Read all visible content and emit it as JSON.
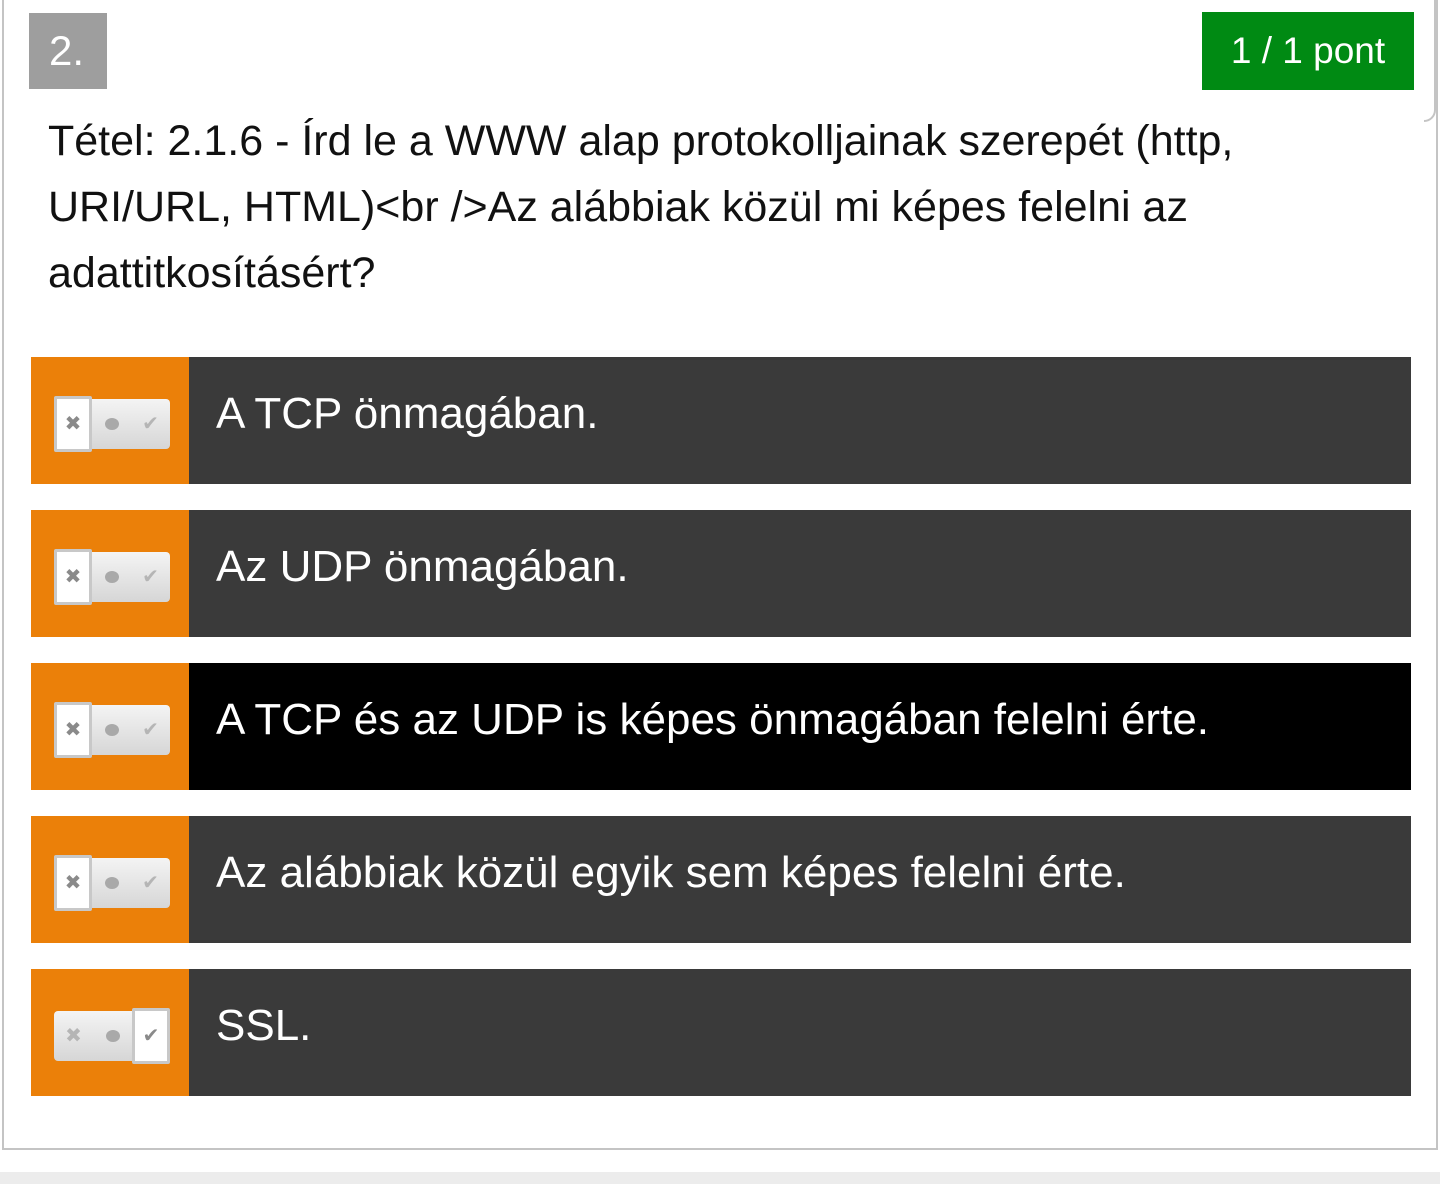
{
  "question": {
    "number": "2.",
    "score": "1 / 1 pont",
    "text": "Tétel: 2.1.6 - Írd le a WWW alap protokolljainak szerepét (http, URI/URL, HTML)<br />Az alábbiak közül mi képes felelni az adattitkosításért?"
  },
  "tri_state_icons": {
    "wrong": "✖",
    "neutral": "●",
    "right": "✔"
  },
  "answers": [
    {
      "label": "A TCP önmagában.",
      "state": "wrong",
      "highlighted": false
    },
    {
      "label": "Az UDP önmagában.",
      "state": "wrong",
      "highlighted": false
    },
    {
      "label": "A TCP és az UDP is képes önmagában felelni érte.",
      "state": "wrong",
      "highlighted": true
    },
    {
      "label": "Az alábbiak közül egyik sem képes felelni érte.",
      "state": "wrong",
      "highlighted": false
    },
    {
      "label": "SSL.",
      "state": "right",
      "highlighted": false
    }
  ],
  "colors": {
    "marker_orange": "#eb8009",
    "answer_dark": "#3a3a3a",
    "answer_highlight": "#000000",
    "score_green": "#008a13",
    "number_gray": "#9e9e9e"
  }
}
